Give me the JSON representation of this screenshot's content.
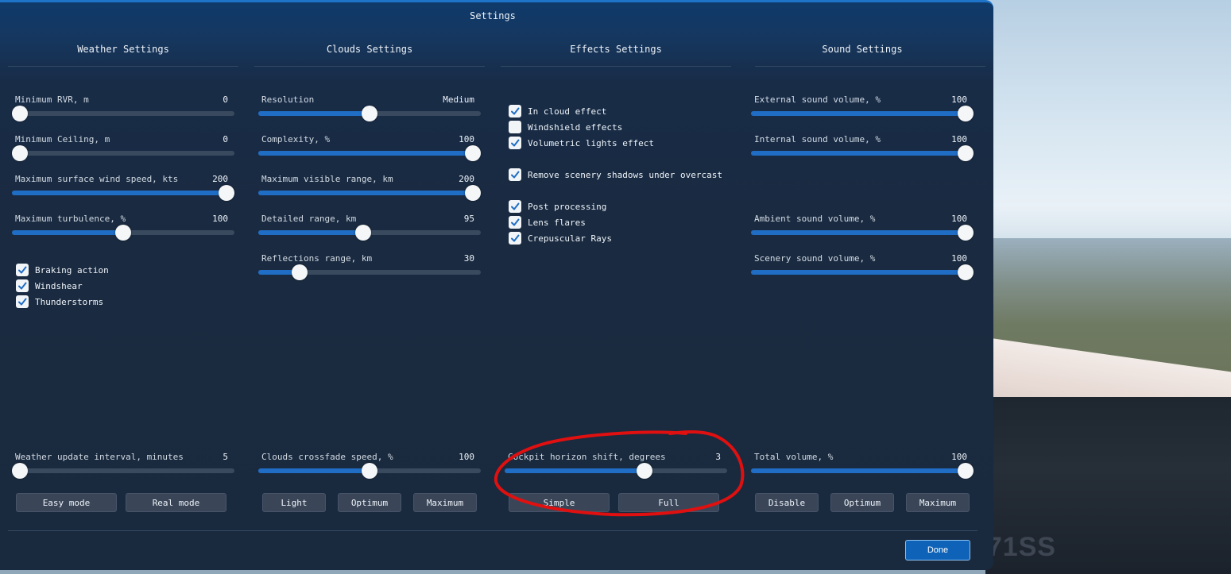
{
  "panel": {
    "title": "Settings",
    "done_label": "Done"
  },
  "weather": {
    "title": "Weather Settings",
    "sliders": [
      {
        "label": "Minimum RVR, m",
        "value": "0",
        "fraction": 0.0
      },
      {
        "label": "Minimum Ceiling, m",
        "value": "0",
        "fraction": 0.0
      },
      {
        "label": "Maximum surface wind speed, kts",
        "value": "200",
        "fraction": 1.0
      },
      {
        "label": "Maximum turbulence, %",
        "value": "100",
        "fraction": 0.5
      }
    ],
    "checks": [
      {
        "label": "Braking action",
        "checked": true
      },
      {
        "label": "Windshear",
        "checked": true
      },
      {
        "label": "Thunderstorms",
        "checked": true
      }
    ],
    "bottom_slider": {
      "label": "Weather update interval, minutes",
      "value": "5",
      "fraction": 0.0
    },
    "buttons": [
      "Easy mode",
      "Real mode"
    ]
  },
  "clouds": {
    "title": "Clouds Settings",
    "sliders": [
      {
        "label": "Resolution",
        "value": "Medium",
        "fraction": 0.5
      },
      {
        "label": "Complexity, %",
        "value": "100",
        "fraction": 1.0
      },
      {
        "label": "Maximum visible range, km",
        "value": "200",
        "fraction": 1.0
      },
      {
        "label": "Detailed range, km",
        "value": "95",
        "fraction": 0.47
      },
      {
        "label": "Reflections range, km",
        "value": "30",
        "fraction": 0.16
      }
    ],
    "bottom_slider": {
      "label": "Clouds crossfade speed, %",
      "value": "100",
      "fraction": 0.5
    },
    "buttons": [
      "Light",
      "Optimum",
      "Maximum"
    ]
  },
  "effects": {
    "title": "Effects Settings",
    "groups": [
      [
        {
          "label": "In cloud effect",
          "checked": true
        },
        {
          "label": "Windshield effects",
          "checked": false
        },
        {
          "label": "Volumetric lights effect",
          "checked": true
        }
      ],
      [
        {
          "label": "Remove scenery shadows under overcast",
          "checked": true
        }
      ],
      [
        {
          "label": "Post processing",
          "checked": true
        },
        {
          "label": "Lens flares",
          "checked": true
        },
        {
          "label": "Crepuscular Rays",
          "checked": true
        }
      ]
    ],
    "bottom_slider": {
      "label": "Cockpit horizon shift, degrees",
      "value": "3",
      "fraction": 0.64
    },
    "buttons": [
      "Simple",
      "Full"
    ]
  },
  "sound": {
    "title": "Sound Settings",
    "sliders_top": [
      {
        "label": "External sound volume, %",
        "value": "100",
        "fraction": 1.0
      },
      {
        "label": "Internal sound volume, %",
        "value": "100",
        "fraction": 1.0
      }
    ],
    "sliders_mid": [
      {
        "label": "Ambient sound volume, %",
        "value": "100",
        "fraction": 1.0
      },
      {
        "label": "Scenery sound volume, %",
        "value": "100",
        "fraction": 1.0
      }
    ],
    "bottom_slider": {
      "label": "Total volume, %",
      "value": "100",
      "fraction": 1.0
    },
    "buttons": [
      "Disable",
      "Optimum",
      "Maximum"
    ]
  },
  "background": {
    "registration": "71SS"
  },
  "colors": {
    "accent": "#1f6dc4",
    "annotation": "#e01010",
    "done": "#0e63b8"
  }
}
